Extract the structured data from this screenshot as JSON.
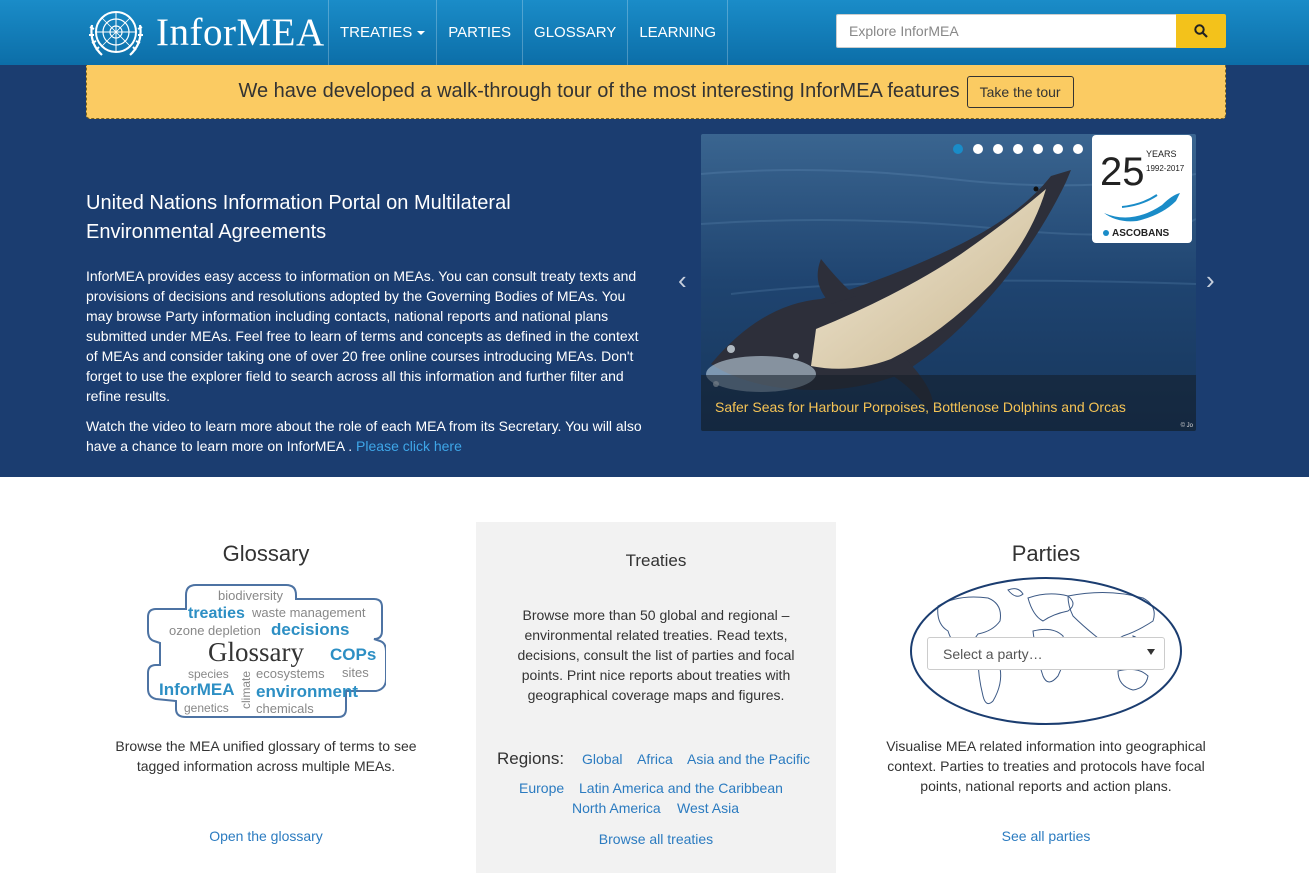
{
  "nav": {
    "brand": "InforMEA",
    "items": [
      {
        "label": "TREATIES",
        "dropdown": true
      },
      {
        "label": "PARTIES"
      },
      {
        "label": "GLOSSARY"
      },
      {
        "label": "LEARNING"
      }
    ],
    "search_placeholder": "Explore InforMEA"
  },
  "tour": {
    "text": "We have developed a walk-through tour of the most interesting InforMEA features",
    "button": "Take the tour"
  },
  "hero": {
    "title": "United Nations Information Portal on Multilateral Environmental Agreements",
    "paragraph1": "InforMEA provides easy access to information on MEAs. You can consult treaty texts and provisions of decisions and resolutions adopted by the Governing Bodies of MEAs. You may browse Party information including contacts, national reports and national plans submitted under MEAs. Feel free to learn of terms and concepts as defined in the context of MEAs and consider taking one of over 20 free online courses introducing MEAs. Don't forget to use the explorer field to search across all this information and further filter and refine results.",
    "paragraph2": "Watch the video to learn more about the role of each MEA from its Secretary. You will also have a chance to learn more on InforMEA .",
    "link": "Please click here"
  },
  "carousel": {
    "caption": "Safer Seas for Harbour Porpoises, Bottlenose Dolphins and Orcas",
    "dots": 7,
    "active_dot": 1,
    "badge_big": "25",
    "badge_small": "YEARS",
    "badge_years": "1992-2017",
    "badge_org": "ASCOBANS",
    "copyright": "© Jo"
  },
  "glossary": {
    "title": "Glossary",
    "cloud_words": [
      "biodiversity",
      "treaties",
      "waste management",
      "ozone depletion",
      "decisions",
      "Glossary",
      "COPs",
      "species",
      "ecosystems",
      "sites",
      "InforMEA",
      "climate",
      "environment",
      "genetics",
      "chemicals"
    ],
    "text": "Browse the MEA unified glossary of terms to see tagged information across multiple MEAs.",
    "link": "Open the glossary"
  },
  "treaties": {
    "title": "Treaties",
    "text": "Browse more than 50 global and regional – environmental related treaties. Read texts, decisions, consult the list of parties and focal points. Print nice reports about treaties with geographical coverage maps and figures.",
    "regions_label": "Regions:",
    "regions": [
      "Global",
      "Africa",
      "Asia and the Pacific",
      "Europe",
      "Latin America and the Caribbean",
      "North America",
      "West Asia"
    ],
    "link": "Browse all treaties"
  },
  "parties": {
    "title": "Parties",
    "select_placeholder": "Select a party…",
    "text": "Visualise MEA related information into geographical context. Parties to treaties and protocols have focal points, national reports and action plans.",
    "link": "See all parties"
  }
}
